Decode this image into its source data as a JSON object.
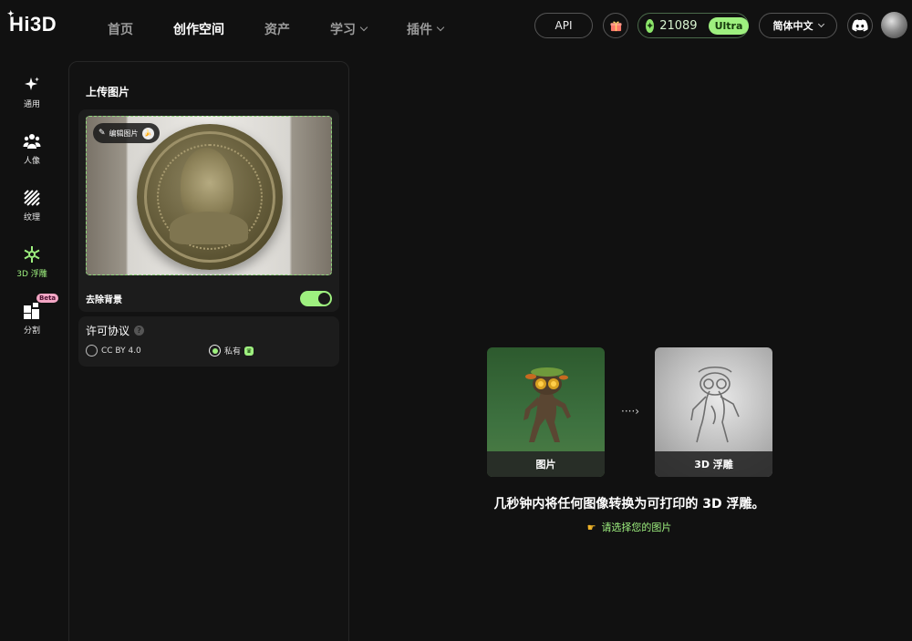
{
  "brand": {
    "logo": "Hi3D"
  },
  "nav": {
    "items": [
      {
        "label": "首页",
        "active": false
      },
      {
        "label": "创作空间",
        "active": true
      },
      {
        "label": "资产",
        "active": false
      },
      {
        "label": "学习",
        "active": false,
        "dropdown": true
      },
      {
        "label": "插件",
        "active": false,
        "dropdown": true
      }
    ]
  },
  "header": {
    "api_label": "API",
    "credits": "21089",
    "plan_badge": "Ultra",
    "language": "简体中文"
  },
  "rail": {
    "items": [
      {
        "label": "通用",
        "icon": "sparkle-icon",
        "active": false
      },
      {
        "label": "人像",
        "icon": "people-icon",
        "active": false
      },
      {
        "label": "纹理",
        "icon": "texture-icon",
        "active": false
      },
      {
        "label": "3D 浮雕",
        "icon": "relief-icon",
        "active": true
      },
      {
        "label": "分割",
        "icon": "segment-icon",
        "active": false,
        "badge": "Beta"
      }
    ]
  },
  "panel": {
    "title": "上传图片",
    "edit_chip": "编辑图片",
    "remove_bg_label": "去除背景",
    "remove_bg_enabled": true,
    "license": {
      "title": "许可协议",
      "options": [
        {
          "label": "CC BY 4.0",
          "selected": false
        },
        {
          "label": "私有",
          "selected": true
        }
      ]
    }
  },
  "showcase": {
    "source_caption": "图片",
    "result_caption": "3D 浮雕",
    "arrow": "····›",
    "headline": "几秒钟内将任何图像转换为可打印的 3D 浮雕。",
    "cta": "请选择您的图片"
  },
  "colors": {
    "accent": "#9ef07f",
    "background": "#111111",
    "card": "#1c1c1c"
  }
}
